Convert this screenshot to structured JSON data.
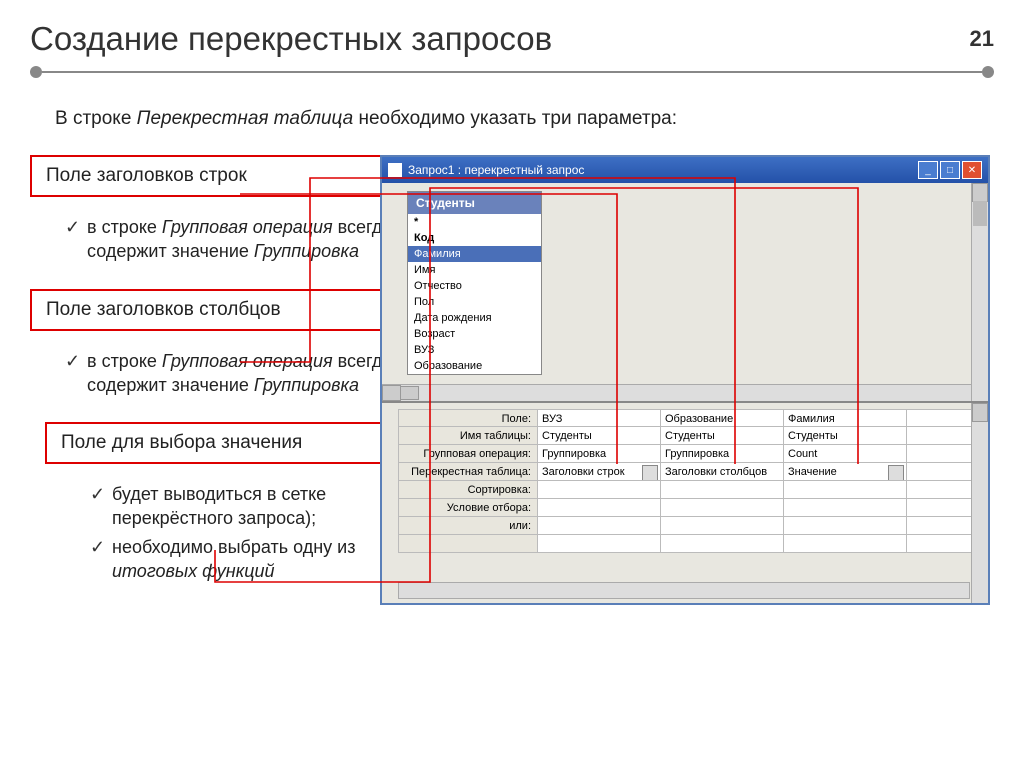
{
  "page_number": "21",
  "title": "Создание перекрестных запросов",
  "intro_pre": "В строке ",
  "intro_em": "Перекрестная таблица",
  "intro_post": " необходимо указать три параметра:",
  "callout1": "Поле заголовков строк",
  "callout2": "Поле заголовков столбцов",
  "callout3": "Поле для выбора значения",
  "note_a_pre": "в строке ",
  "note_a_em1": "Групповая операция",
  "note_a_mid": " всегда содержит значение ",
  "note_a_em2": "Группировка",
  "note_b_pre": "в строке ",
  "note_b_em1": "Групповая операция",
  "note_b_mid": " всегда содержит значение ",
  "note_b_em2": "Группировка",
  "note_c1": "будет выводиться в сетке перекрёстного запроса);",
  "note_c2_pre": "необходимо выбрать одну из ",
  "note_c2_em": "итоговых функций",
  "window_title": "Запрос1 : перекрестный запрос",
  "table_name": "Студенты",
  "fields": {
    "star": "*",
    "f0": "Код",
    "f1": "Фамилия",
    "f2": "Имя",
    "f3": "Отчество",
    "f4": "Пол",
    "f5": "Дата рождения",
    "f6": "Возраст",
    "f7": "ВУЗ",
    "f8": "Образование"
  },
  "grid": {
    "labels": {
      "r0": "Поле:",
      "r1": "Имя таблицы:",
      "r2": "Групповая операция:",
      "r3": "Перекрестная таблица:",
      "r4": "Сортировка:",
      "r5": "Условие отбора:",
      "r6": "или:",
      "r7": ""
    },
    "cols": [
      {
        "r0": "ВУЗ",
        "r1": "Студенты",
        "r2": "Группировка",
        "r3": "Заголовки строк",
        "r4": "",
        "r5": "",
        "r6": "",
        "r7": ""
      },
      {
        "r0": "Образование",
        "r1": "Студенты",
        "r2": "Группировка",
        "r3": "Заголовки столбцов",
        "r4": "",
        "r5": "",
        "r6": "",
        "r7": ""
      },
      {
        "r0": "Фамилия",
        "r1": "Студенты",
        "r2": "Count",
        "r3": "Значение",
        "r4": "",
        "r5": "",
        "r6": "",
        "r7": ""
      }
    ]
  }
}
